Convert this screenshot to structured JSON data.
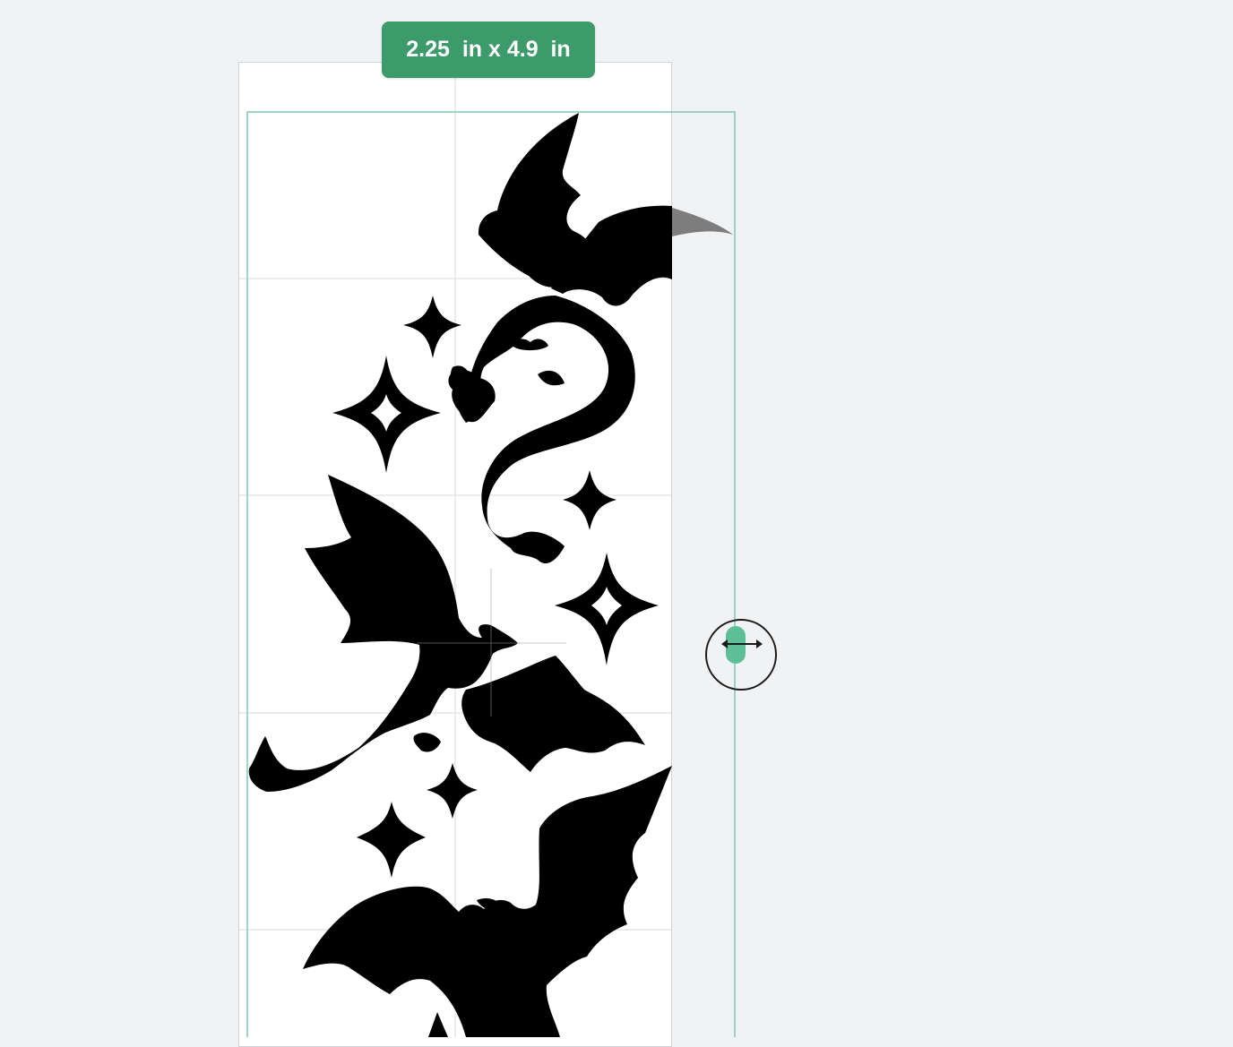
{
  "size_badge": {
    "label": "2.25  in x 4.9  in"
  },
  "icons": {
    "resize_handle": "horizontal-resize-arrows-icon",
    "art": "dragons-and-sparkles-artwork"
  },
  "colors": {
    "background": "#f1f2f4",
    "mat": "#ffffff",
    "grid": "#d8dadd",
    "selection": "#7fc7b4",
    "badge": "#3d9a6b",
    "handle": "#5cbf97",
    "art": "#000000"
  }
}
